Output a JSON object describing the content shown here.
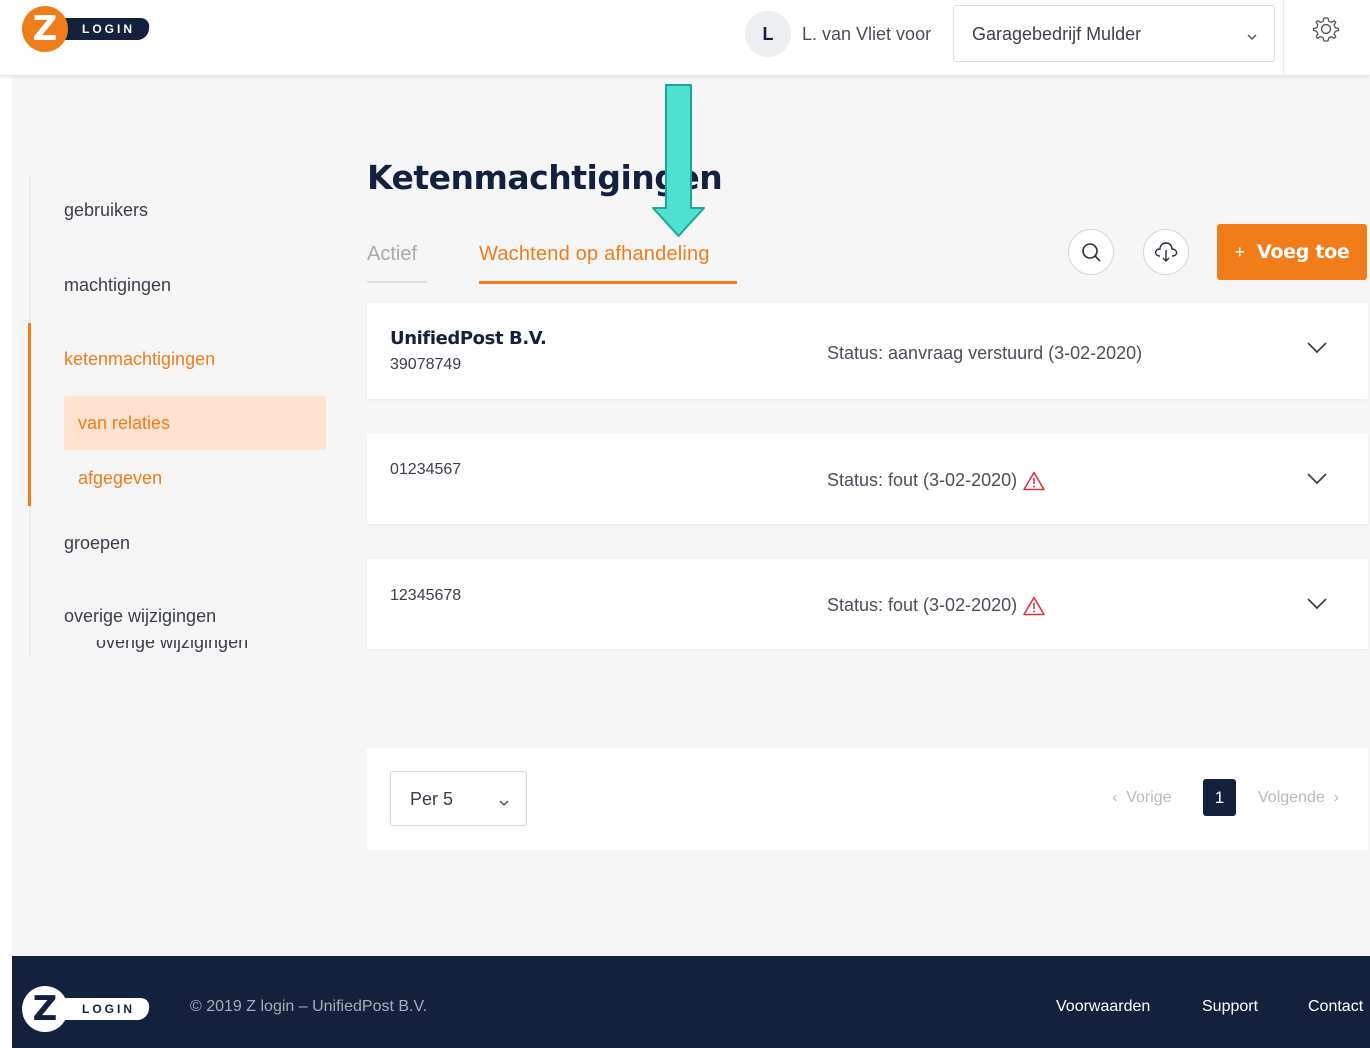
{
  "header": {
    "logo_text": "LOGIN",
    "logo_letter": "Z",
    "avatar_initial": "L",
    "user_label": "L. van Vliet voor",
    "organization": "Garagebedrijf Mulder"
  },
  "sidebar": {
    "items": [
      {
        "label": "gebruikers"
      },
      {
        "label": "machtigingen"
      },
      {
        "label": "ketenmachtigingen"
      },
      {
        "label": "groepen"
      },
      {
        "label": "overige wijzigingen"
      }
    ],
    "sub_items": [
      {
        "label": "van relaties"
      },
      {
        "label": "afgegeven"
      }
    ],
    "ghost_label": "overige wijzigingen"
  },
  "main": {
    "title": "Ketenmachtigingen",
    "tabs": [
      {
        "label": "Actief"
      },
      {
        "label": "Wachtend op afhandeling"
      }
    ],
    "add_button": {
      "plus": "+",
      "label": "Voeg toe"
    },
    "rows": [
      {
        "name": "UnifiedPost B.V.",
        "number": "39078749",
        "status": "Status: aanvraag verstuurd (3-02-2020)"
      },
      {
        "name": "",
        "number": "01234567",
        "status": "Status: fout (3-02-2020)"
      },
      {
        "name": "",
        "number": "12345678",
        "status": "Status: fout (3-02-2020)"
      }
    ]
  },
  "pagination": {
    "per_page": "Per 5",
    "prev": "Vorige",
    "page": "1",
    "next": "Volgende"
  },
  "footer": {
    "logo_text": "LOGIN",
    "logo_letter": "Z",
    "copyright": "© 2019 Z login – UnifiedPost B.V.",
    "links": [
      {
        "label": "Voorwaarden"
      },
      {
        "label": "Support"
      },
      {
        "label": "Contact"
      }
    ]
  },
  "colors": {
    "accent": "#f07c1a",
    "navy": "#14213d",
    "arrow": "#4fe0cf",
    "warning": "#d9363e"
  },
  "icons": [
    "chevron-down-icon",
    "gear-icon",
    "search-icon",
    "cloud-download-icon",
    "warning-icon",
    "arrow-down-icon"
  ]
}
